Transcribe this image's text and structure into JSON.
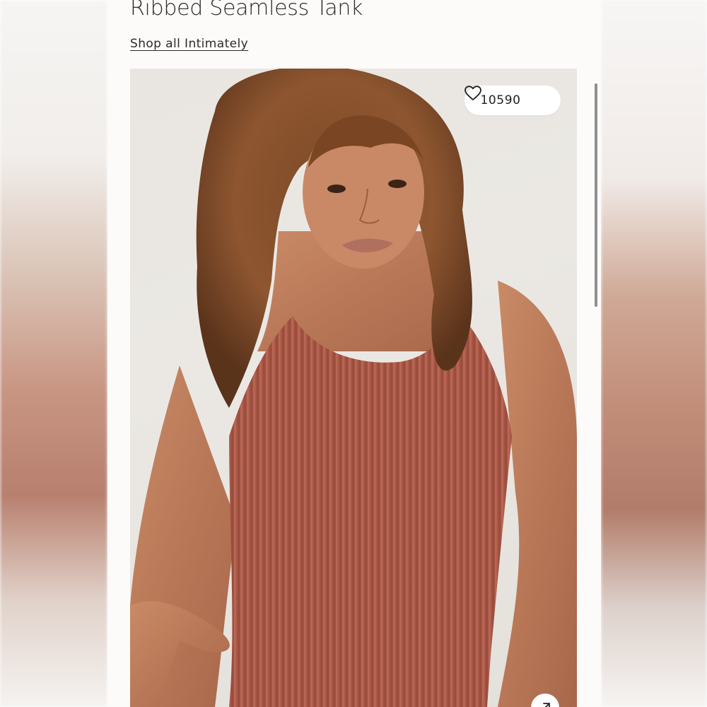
{
  "product": {
    "title": "Ribbed Seamless Tank",
    "shop_all_link": "Shop all Intimately",
    "image_alt": "Model wearing a rust ribbed seamless tank top"
  },
  "favorites": {
    "count": "10590",
    "icon": "heart-outline-icon"
  },
  "image_controls": {
    "expand_icon": "expand-arrow-icon"
  },
  "colors": {
    "page_background": "#fdfbfa",
    "text": "#2b2b2b",
    "tank_color": "#b35e4c"
  }
}
